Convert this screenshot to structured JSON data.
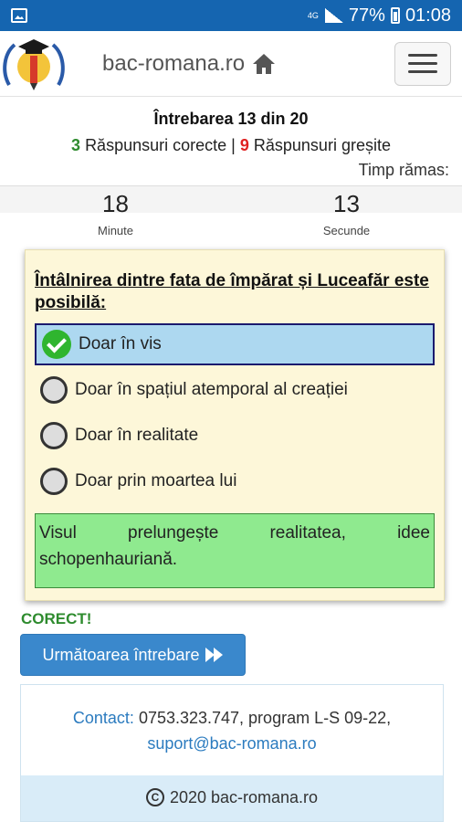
{
  "statusbar": {
    "network": "4G",
    "battery": "77%",
    "time": "01:08"
  },
  "header": {
    "brand": "bac-romana.ro"
  },
  "quiz": {
    "question_counter": "Întrebarea 13 din 20",
    "correct_count": "3",
    "correct_label": "Răspunsuri corecte",
    "separator": "|",
    "wrong_count": "9",
    "wrong_label": "Răspunsuri greșite",
    "time_left_label": "Timp rămas:",
    "minutes": "18",
    "seconds": "13",
    "minutes_label": "Minute",
    "seconds_label": "Secunde"
  },
  "question": {
    "text": "Întâlnirea dintre fata de împărat și Luceafăr este posibilă:",
    "options": [
      {
        "label": "Doar în vis"
      },
      {
        "label": "Doar în spațiul atemporal al creației"
      },
      {
        "label": "Doar în realitate"
      },
      {
        "label": "Doar prin moartea lui"
      }
    ],
    "explanation": "Visul prelungește realitatea, idee schopenhauriană."
  },
  "result": "CORECT!",
  "next_button": "Următoarea întrebare",
  "footer": {
    "contact_label": "Contact:",
    "contact_text": "0753.323.747, program L-S 09-22,",
    "email": "suport@bac-romana.ro",
    "copyright": "2020 bac-romana.ro"
  },
  "colors": {
    "statusbar": "#1565b0",
    "correct": "#2e8b2e",
    "wrong": "#e02020",
    "button": "#3a88cc",
    "card": "#fdf7d9",
    "selected": "#add8f0",
    "explanation": "#8fea8f"
  }
}
